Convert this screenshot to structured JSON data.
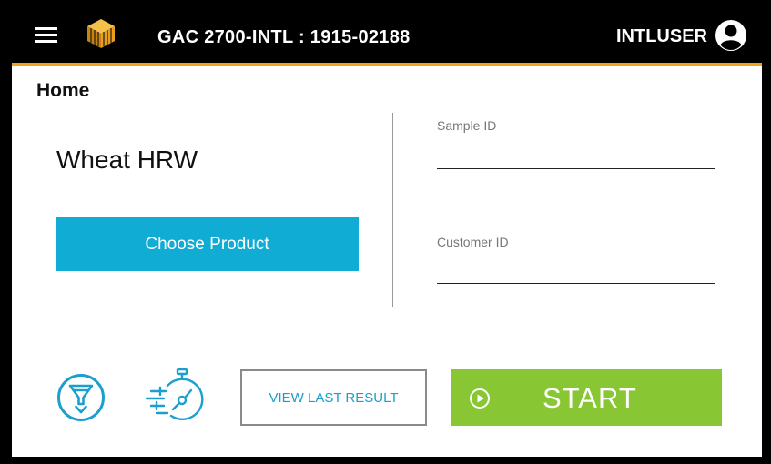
{
  "header": {
    "title": "GAC 2700-INTL : 1915-02188",
    "user": "INTLUSER",
    "menu_icon": "hamburger-menu-icon",
    "logo_icon": "brand-logo-icon",
    "user_icon": "account-circle-icon"
  },
  "page": {
    "title": "Home"
  },
  "product": {
    "name": "Wheat HRW",
    "choose_label": "Choose Product"
  },
  "fields": {
    "sample_id_label": "Sample ID",
    "sample_id_value": "",
    "customer_id_label": "Customer ID",
    "customer_id_value": ""
  },
  "actions": {
    "filter_icon": "funnel-filter-icon",
    "timer_icon": "fast-stopwatch-icon",
    "view_last_label": "VIEW LAST RESULT",
    "start_label": "START",
    "start_icon": "play-circle-icon"
  },
  "colors": {
    "accent_bar": "#f0a31c",
    "primary_blue": "#10acd4",
    "start_green": "#88c633",
    "link_blue": "#1b9fcc"
  }
}
